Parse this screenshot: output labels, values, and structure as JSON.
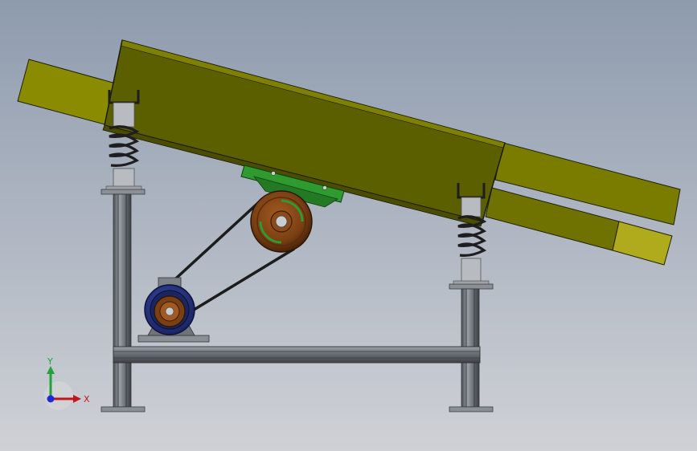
{
  "axis_triad": {
    "x_label": "X",
    "y_label": "Y",
    "x_color": "#c0171b",
    "y_color": "#21a33b",
    "z_color": "#1d2bd6"
  },
  "colors": {
    "background_top": "#8e9bae",
    "background_bottom": "#cfd1d6",
    "screen_body": "#5c5f00",
    "screen_top_face": "#7f8000",
    "chute": "#7a7c00",
    "chute_light": "#aaa61a",
    "frame": "#6f7478",
    "frame_dark": "#3f4347",
    "spring": "#222222",
    "spring_cup": "#b8bcc0",
    "pulley": "#7a3f12",
    "pulley_rim": "#5a2c0c",
    "bearing_mount": "#2f9a2f",
    "motor": "#2a3a8a",
    "belt": "#1c1c1c"
  }
}
